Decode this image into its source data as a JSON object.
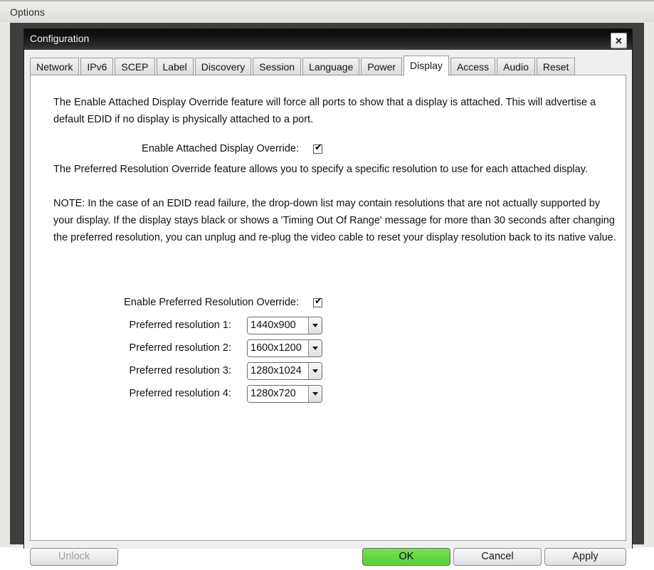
{
  "outer_window": {
    "title": "Options"
  },
  "dialog": {
    "title": "Configuration",
    "close_label": "✕"
  },
  "tabs": [
    {
      "label": "Network",
      "active": false
    },
    {
      "label": "IPv6",
      "active": false
    },
    {
      "label": "SCEP",
      "active": false
    },
    {
      "label": "Label",
      "active": false
    },
    {
      "label": "Discovery",
      "active": false
    },
    {
      "label": "Session",
      "active": false
    },
    {
      "label": "Language",
      "active": false
    },
    {
      "label": "Power",
      "active": false
    },
    {
      "label": "Display",
      "active": true
    },
    {
      "label": "Access",
      "active": false
    },
    {
      "label": "Audio",
      "active": false
    },
    {
      "label": "Reset",
      "active": false
    }
  ],
  "display_tab": {
    "attached_paragraph": "The Enable Attached Display Override feature will force all ports to show that a display is attached. This will advertise a default EDID if no display is physically attached to a port.",
    "attached_override": {
      "label": "Enable Attached Display Override:",
      "checked": true,
      "check_glyph": "✔"
    },
    "preferred_paragraph": "The Preferred Resolution Override feature allows you to specify a specific resolution to use for each attached display.",
    "note_paragraph": "NOTE: In the case of an EDID read failure, the drop-down list may contain resolutions that are not actually supported by your display. If the display stays black or shows a 'Timing Out Of Range' message for more than 30 seconds after changing the preferred resolution, you can unplug and re-plug the video cable to reset your display resolution back to its native value.",
    "preferred_override": {
      "label": "Enable Preferred Resolution Override:",
      "checked": true,
      "check_glyph": "✔"
    },
    "resolutions": [
      {
        "label": "Preferred resolution 1:",
        "value": "1440x900"
      },
      {
        "label": "Preferred resolution 2:",
        "value": "1600x1200"
      },
      {
        "label": "Preferred resolution 3:",
        "value": "1280x1024"
      },
      {
        "label": "Preferred resolution 4:",
        "value": "1280x720"
      }
    ]
  },
  "buttons": {
    "unlock": "Unlock",
    "ok": "OK",
    "cancel": "Cancel",
    "apply": "Apply"
  },
  "colors": {
    "ok_green": "#63d63f",
    "titlebar_dark": "#101010",
    "backdrop": "#3f3f3f"
  }
}
